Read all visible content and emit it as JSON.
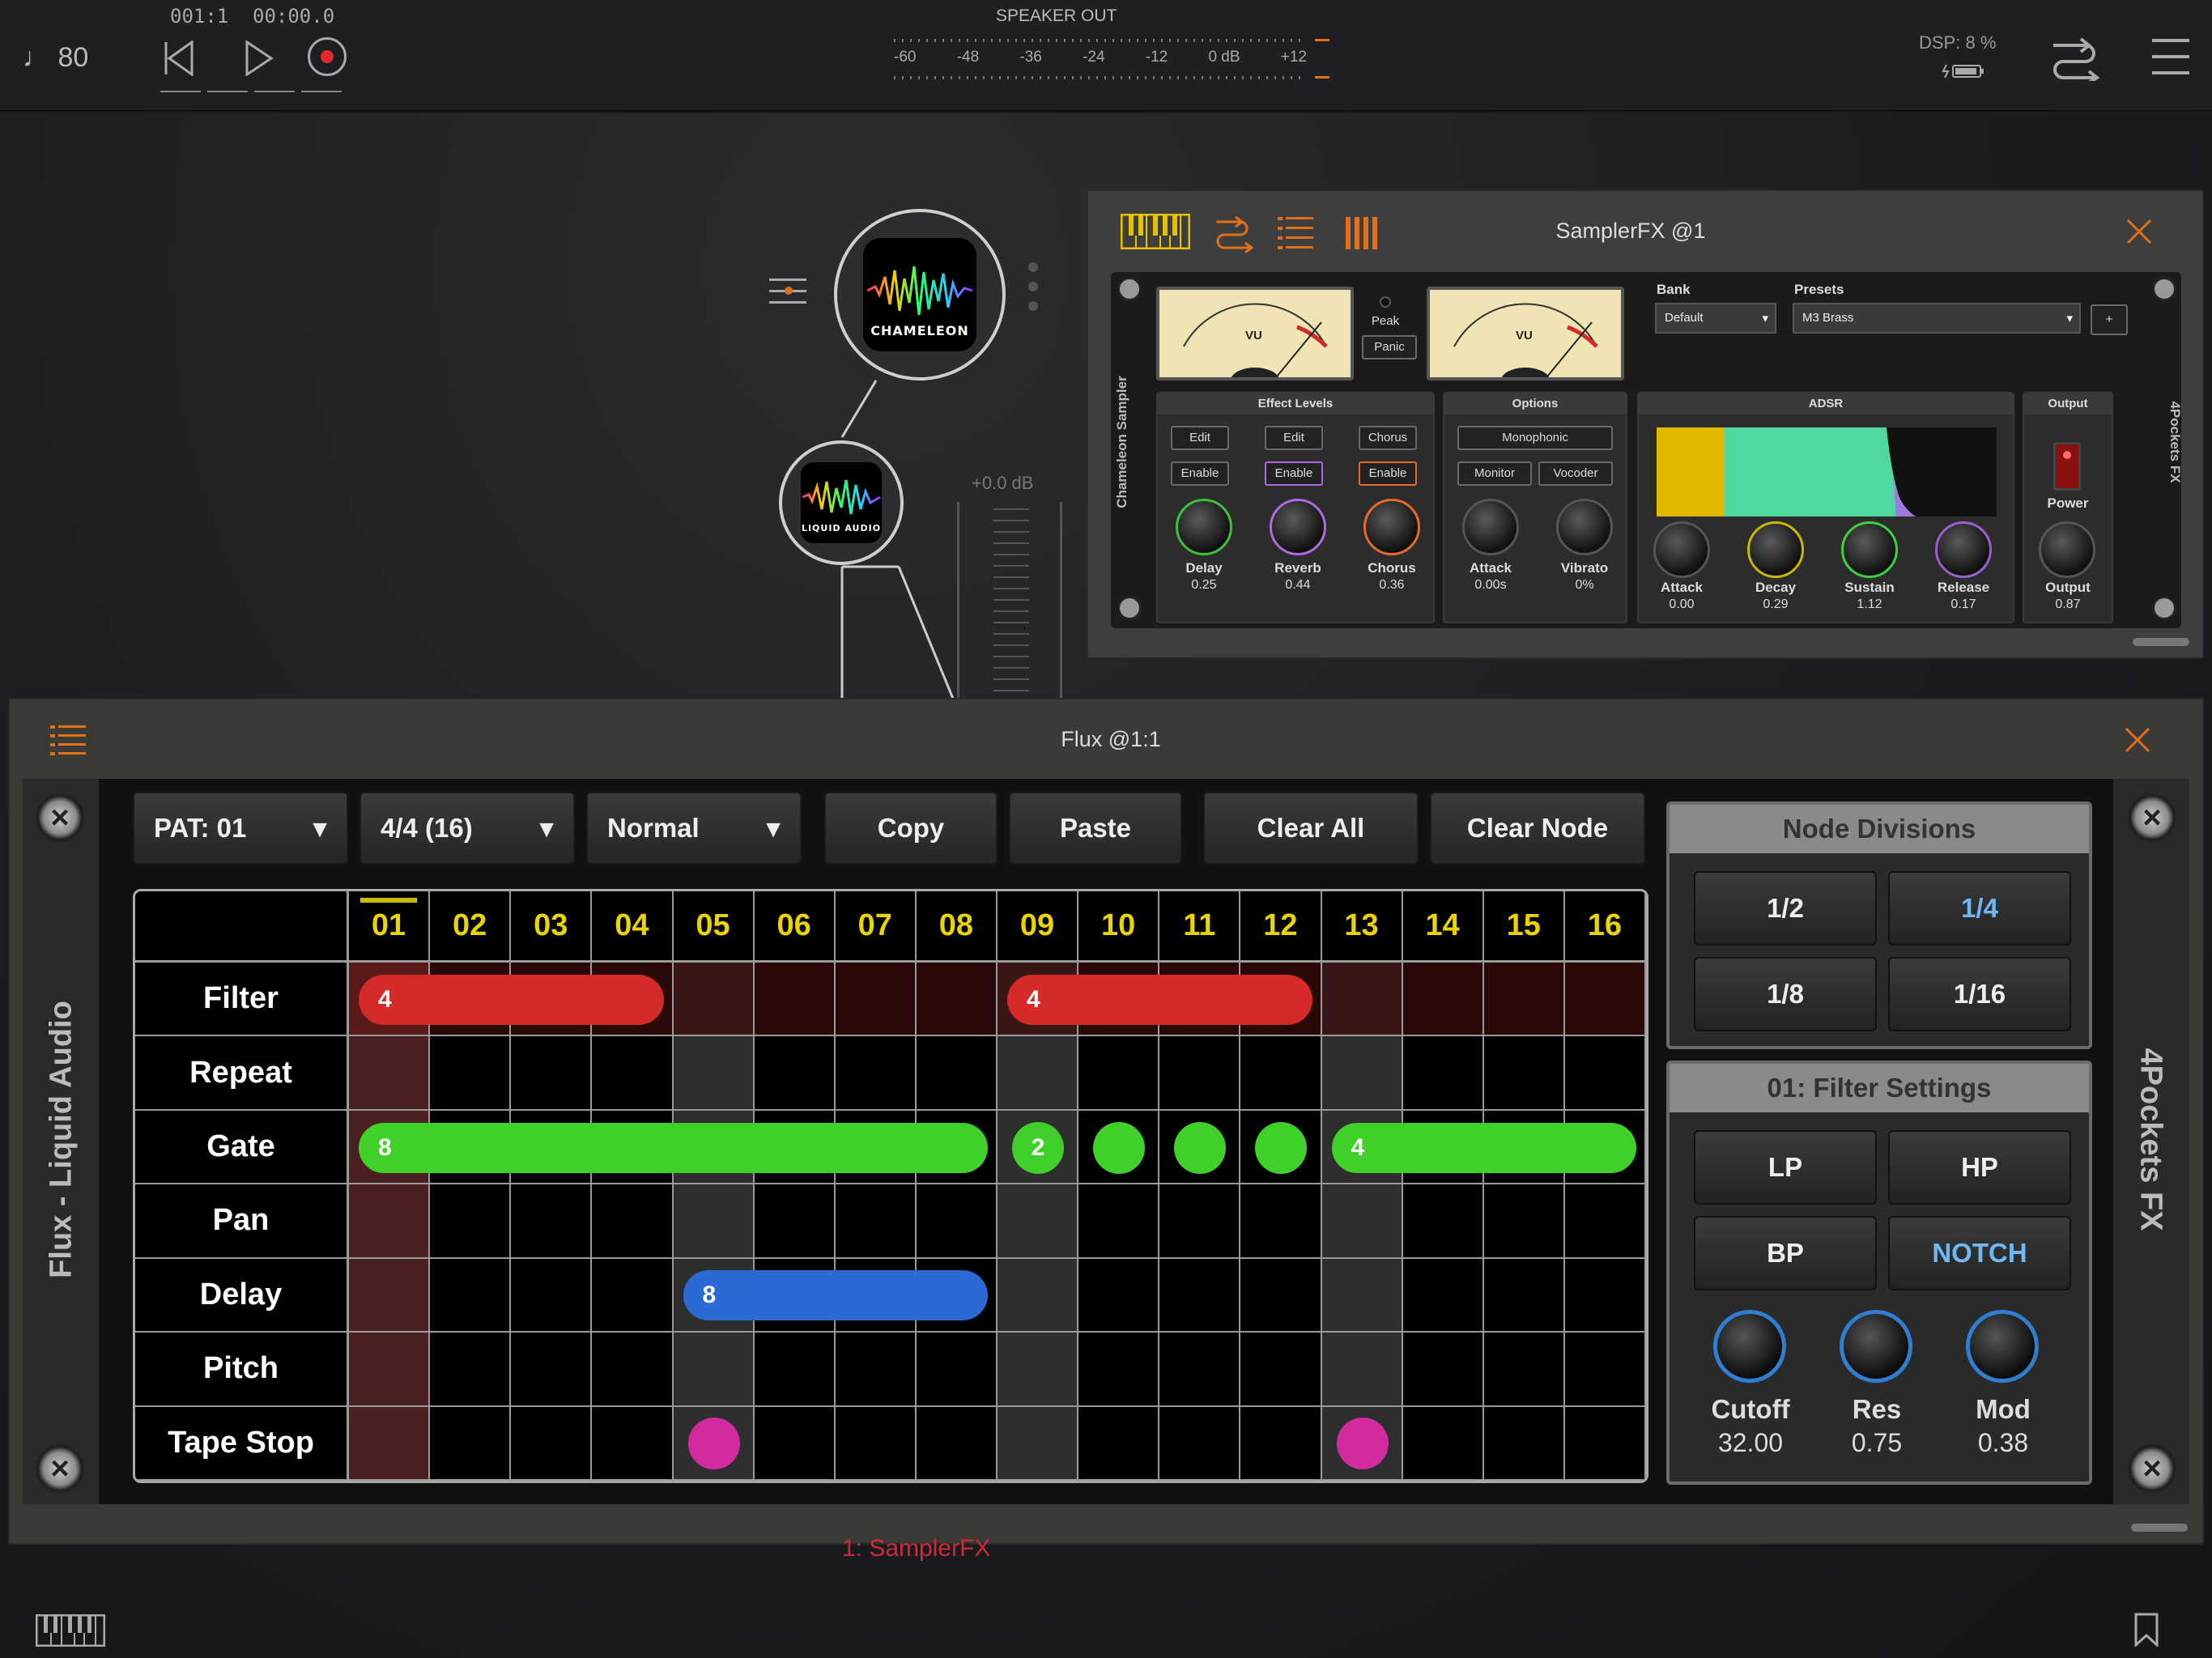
{
  "topbar": {
    "tempo": "80",
    "position": "001:1",
    "time": "00:00.0",
    "meter_title": "SPEAKER OUT",
    "meter_ticks": [
      "-60",
      "-48",
      "-36",
      "-24",
      "-12",
      "0 dB",
      "+12"
    ],
    "dsp_label": "DSP:",
    "dsp_value": "8 %",
    "icons": [
      "note-icon",
      "skip-back-icon",
      "play-icon",
      "record-icon",
      "routing-icon",
      "menu-icon",
      "battery-icon"
    ]
  },
  "canvas": {
    "node1_label": "CHAMELEON",
    "node2_label": "LIQUID AUDIO",
    "fader_level": "+0.0 dB",
    "bottom_label": "1: SamplerFX"
  },
  "samplerfx": {
    "title": "SamplerFX @1",
    "left_side_text": "Chameleon Sampler",
    "right_side_text": "4Pockets FX",
    "vu_label": "VU",
    "peak_label": "Peak",
    "panic_label": "Panic",
    "bank_label": "Bank",
    "bank_value": "Default",
    "presets_label": "Presets",
    "preset_value": "M3 Brass",
    "plus_label": "+",
    "effect_levels": {
      "title": "Effect Levels",
      "edit_labels": [
        "Edit",
        "Edit",
        "Chorus"
      ],
      "enable_labels": [
        "Enable",
        "Enable",
        "Enable"
      ],
      "knobs": [
        {
          "label": "Delay",
          "value": "0.25",
          "color": "#3fbf3f"
        },
        {
          "label": "Reverb",
          "value": "0.44",
          "color": "#b06adf"
        },
        {
          "label": "Chorus",
          "value": "0.36",
          "color": "#e86a2a"
        }
      ]
    },
    "options": {
      "title": "Options",
      "mono_label": "Monophonic",
      "monitor_label": "Monitor",
      "vocoder_label": "Vocoder",
      "knobs": [
        {
          "label": "Attack",
          "value": "0.00s"
        },
        {
          "label": "Vibrato",
          "value": "0%"
        }
      ]
    },
    "adsr": {
      "title": "ADSR",
      "knobs": [
        {
          "label": "Attack",
          "value": "0.00",
          "color": "#555"
        },
        {
          "label": "Decay",
          "value": "0.29",
          "color": "#c9b800"
        },
        {
          "label": "Sustain",
          "value": "1.12",
          "color": "#3fcf3f"
        },
        {
          "label": "Release",
          "value": "0.17",
          "color": "#9a5fd0"
        }
      ]
    },
    "output": {
      "title": "Output",
      "power_label": "Power",
      "knob_label": "Output",
      "knob_value": "0.87"
    }
  },
  "flux": {
    "title": "Flux @1:1",
    "left_side_text": "Flux - Liquid Audio",
    "right_side_text": "4Pockets FX",
    "toolbar": {
      "pattern": "PAT: 01",
      "length": "4/4 (16)",
      "mode": "Normal",
      "copy": "Copy",
      "paste": "Paste",
      "clear_all": "Clear All",
      "clear_node": "Clear Node"
    },
    "columns": [
      "01",
      "02",
      "03",
      "04",
      "05",
      "06",
      "07",
      "08",
      "09",
      "10",
      "11",
      "12",
      "13",
      "14",
      "15",
      "16"
    ],
    "rows": [
      "Filter",
      "Repeat",
      "Gate",
      "Pan",
      "Delay",
      "Pitch",
      "Tape Stop"
    ],
    "events": [
      {
        "row": 0,
        "start": 1,
        "len": 4,
        "label": "4",
        "color": "#d42a2a"
      },
      {
        "row": 0,
        "start": 9,
        "len": 4,
        "label": "4",
        "color": "#d42a2a"
      },
      {
        "row": 2,
        "start": 1,
        "len": 8,
        "label": "8",
        "color": "#3fd12a"
      },
      {
        "row": 2,
        "start": 9,
        "len": 1,
        "label": "2",
        "color": "#3fd12a"
      },
      {
        "row": 2,
        "start": 10,
        "len": 1,
        "label": "",
        "color": "#3fd12a"
      },
      {
        "row": 2,
        "start": 11,
        "len": 1,
        "label": "",
        "color": "#3fd12a"
      },
      {
        "row": 2,
        "start": 12,
        "len": 1,
        "label": "",
        "color": "#3fd12a"
      },
      {
        "row": 2,
        "start": 13,
        "len": 4,
        "label": "4",
        "color": "#3fd12a"
      },
      {
        "row": 4,
        "start": 5,
        "len": 4,
        "label": "8",
        "color": "#2a6ad4"
      },
      {
        "row": 6,
        "start": 5,
        "len": 1,
        "label": "",
        "color": "#d42aa0"
      },
      {
        "row": 6,
        "start": 13,
        "len": 1,
        "label": "",
        "color": "#d42aa0"
      }
    ],
    "node_divisions": {
      "title": "Node Divisions",
      "options": [
        "1/2",
        "1/4",
        "1/8",
        "1/16"
      ],
      "selected": "1/4"
    },
    "filter_settings": {
      "title": "01: Filter Settings",
      "types": [
        "LP",
        "HP",
        "BP",
        "NOTCH"
      ],
      "selected": "NOTCH",
      "knobs": [
        {
          "label": "Cutoff",
          "value": "32.00"
        },
        {
          "label": "Res",
          "value": "0.75"
        },
        {
          "label": "Mod",
          "value": "0.38"
        }
      ]
    }
  }
}
